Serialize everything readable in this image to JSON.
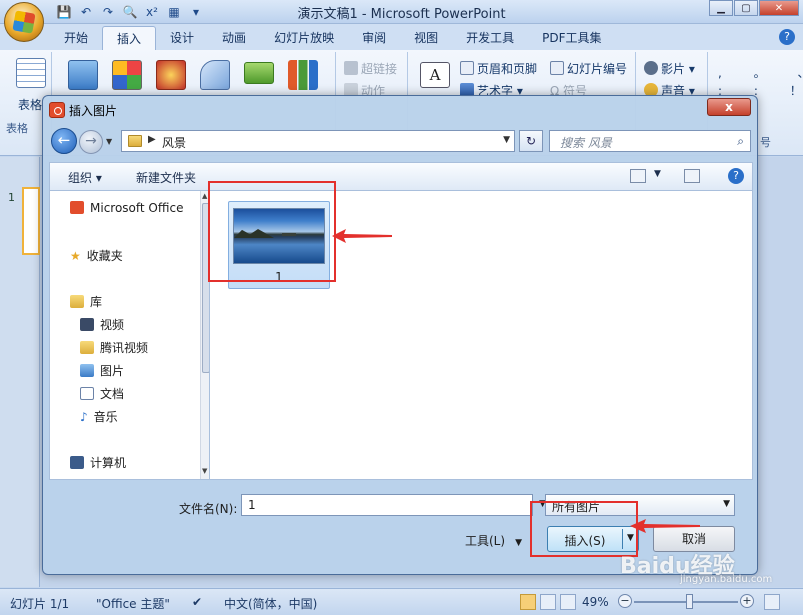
{
  "app": {
    "title": "演示文稿1 - Microsoft PowerPoint",
    "tabs": [
      "开始",
      "插入",
      "设计",
      "动画",
      "幻灯片放映",
      "审阅",
      "视图",
      "开发工具",
      "PDF工具集"
    ],
    "active_tab": "插入",
    "ribbon": {
      "group_table_label": "表格",
      "group_table_short": "表格",
      "hyperlink": "超链接",
      "action": "动作",
      "header_footer": "页眉和页脚",
      "wordart": "艺术字",
      "slide_number": "幻灯片编号",
      "symbol": "符号",
      "movie": "影片",
      "sound": "声音",
      "side_label": "号"
    }
  },
  "dialog": {
    "title": "插入图片",
    "close": "x",
    "breadcrumb": "风景",
    "search_placeholder": "搜索 风景",
    "toolbar": {
      "organize": "组织",
      "new_folder": "新建文件夹"
    },
    "nav": {
      "items": [
        "Microsoft Office",
        "收藏夹",
        "库",
        "视频",
        "腾讯视频",
        "图片",
        "文档",
        "音乐",
        "计算机"
      ]
    },
    "files": [
      {
        "name": "1"
      }
    ],
    "filename_label": "文件名(N):",
    "filename_value": "1",
    "file_type": "所有图片",
    "tools_label": "工具(L)",
    "insert_label": "插入(S)",
    "cancel_label": "取消"
  },
  "status": {
    "slide": "幻灯片 1/1",
    "theme": "\"Office 主题\"",
    "language": "中文(简体，中国)",
    "zoom": "49%"
  },
  "watermark": {
    "text": "Baidu经验",
    "sub": "jingyan.baidu.com"
  },
  "colors": {
    "highlight": "#e3302c",
    "accent": "#2a6fc9"
  }
}
